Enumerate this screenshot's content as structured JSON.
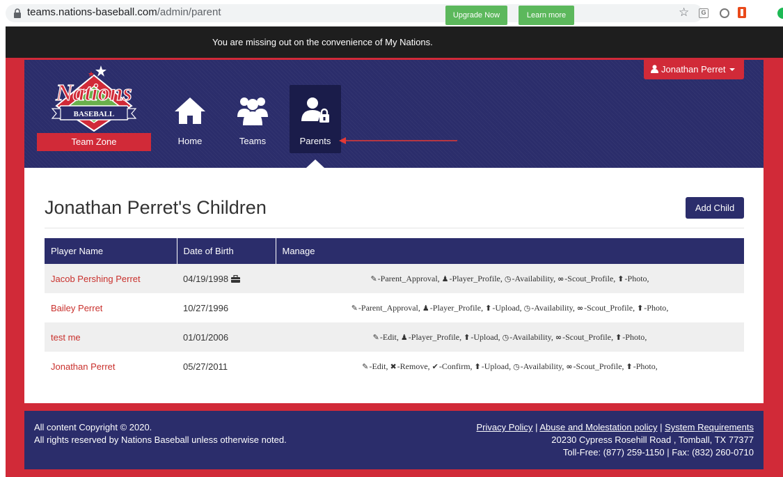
{
  "browser": {
    "url_host": "teams.nations-baseball.com",
    "url_path": "/admin/parent",
    "extension_g_label": "G"
  },
  "promo": {
    "text": "You are missing out on the convenience of My Nations.",
    "upgrade_label": "Upgrade Now",
    "learn_label": "Learn more"
  },
  "header": {
    "logo_top": "Nations",
    "logo_banner": "BASEBALL",
    "team_zone_label": "Team Zone",
    "nav": [
      {
        "label": "Home",
        "icon": "home-icon"
      },
      {
        "label": "Teams",
        "icon": "teams-icon"
      },
      {
        "label": "Parents",
        "icon": "parents-icon",
        "active": true
      }
    ],
    "user_name": "Jonathan Perret"
  },
  "main": {
    "title": "Jonathan Perret's Children",
    "add_child_label": "Add Child",
    "columns": [
      "Player Name",
      "Date of Birth",
      "Manage"
    ],
    "rows": [
      {
        "name": "Jacob Pershing Perret",
        "dob": "04/19/1998",
        "has_badge": true,
        "actions": [
          {
            "label": "Parent_Approval",
            "icon": "edit-icon"
          },
          {
            "label": "Player_Profile",
            "icon": "user-icon"
          },
          {
            "label": "Availability",
            "icon": "clock-icon"
          },
          {
            "label": "Scout_Profile",
            "icon": "glasses-icon"
          },
          {
            "label": "Photo",
            "icon": "upload-icon"
          }
        ]
      },
      {
        "name": "Bailey Perret",
        "dob": "10/27/1996",
        "has_badge": false,
        "actions": [
          {
            "label": "Parent_Approval",
            "icon": "edit-icon"
          },
          {
            "label": "Player_Profile",
            "icon": "user-icon"
          },
          {
            "label": "Upload",
            "icon": "upload-icon"
          },
          {
            "label": "Availability",
            "icon": "clock-icon"
          },
          {
            "label": "Scout_Profile",
            "icon": "glasses-icon"
          },
          {
            "label": "Photo",
            "icon": "upload-icon"
          }
        ]
      },
      {
        "name": "test me",
        "dob": "01/01/2006",
        "has_badge": false,
        "actions": [
          {
            "label": "Edit",
            "icon": "edit-icon",
            "dark": true
          },
          {
            "label": "Player_Profile",
            "icon": "user-icon"
          },
          {
            "label": "Upload",
            "icon": "upload-icon"
          },
          {
            "label": "Availability",
            "icon": "clock-icon"
          },
          {
            "label": "Scout_Profile",
            "icon": "glasses-icon"
          },
          {
            "label": "Photo",
            "icon": "upload-icon"
          }
        ]
      },
      {
        "name": "Jonathan Perret",
        "dob": "05/27/2011",
        "has_badge": false,
        "actions": [
          {
            "label": "Edit",
            "icon": "edit-icon",
            "dark": true
          },
          {
            "label": "Remove",
            "icon": "remove-icon"
          },
          {
            "label": "Confirm",
            "icon": "check-icon"
          },
          {
            "label": "Upload",
            "icon": "upload-icon"
          },
          {
            "label": "Availability",
            "icon": "clock-icon"
          },
          {
            "label": "Scout_Profile",
            "icon": "glasses-icon"
          },
          {
            "label": "Photo",
            "icon": "upload-icon"
          }
        ]
      }
    ]
  },
  "footer": {
    "copyright": "All content Copyright © 2020.",
    "rights": "All rights reserved by Nations Baseball unless otherwise noted.",
    "links": [
      "Privacy Policy",
      "Abuse and Molestation policy",
      "System Requirements"
    ],
    "separator": "|",
    "address": "20230 Cypress Rosehill Road , Tomball, TX 77377",
    "phone": "Toll-Free: (877) 259-1150 | Fax: (832) 260-0710"
  },
  "colors": {
    "navy": "#2b2d6b",
    "red": "#d12a38",
    "green": "#5cb85c",
    "link_red": "#c9302c"
  }
}
